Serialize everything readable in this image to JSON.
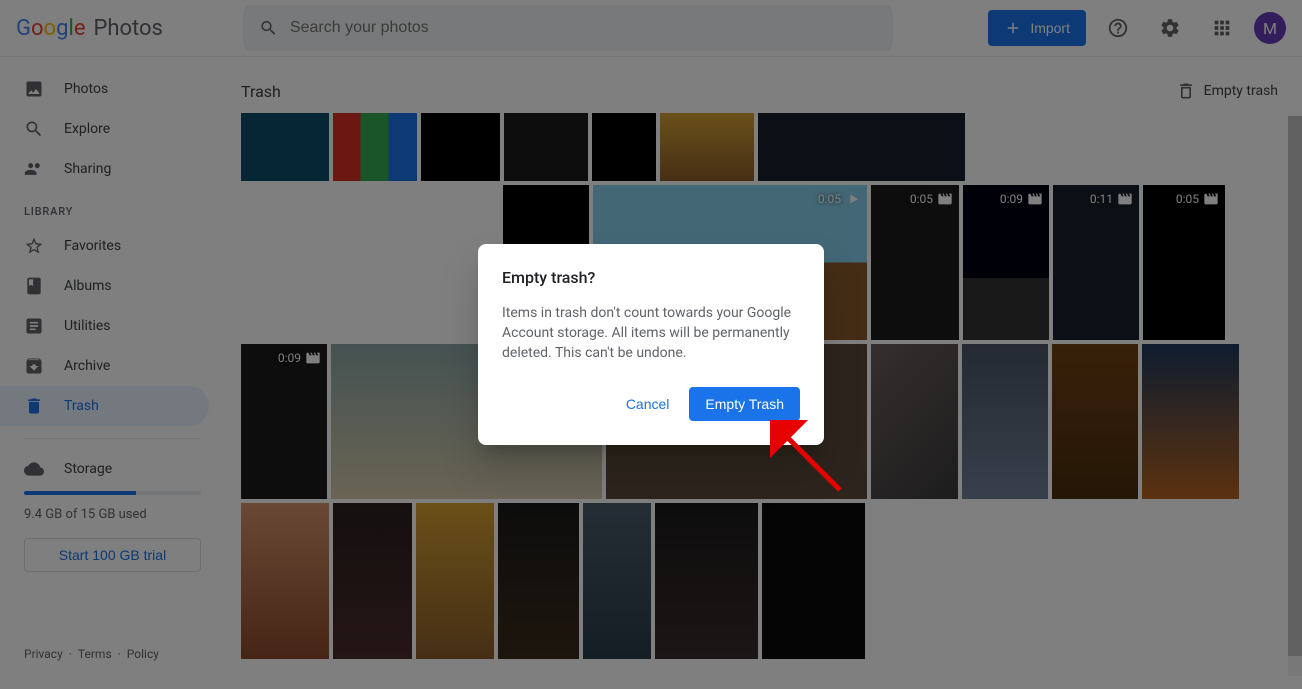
{
  "header": {
    "logo_suffix": "Photos",
    "search_placeholder": "Search your photos",
    "import_label": "Import",
    "avatar_letter": "M"
  },
  "sidebar": {
    "nav": [
      {
        "label": "Photos",
        "icon": "photo-icon"
      },
      {
        "label": "Explore",
        "icon": "search-icon"
      },
      {
        "label": "Sharing",
        "icon": "people-icon"
      }
    ],
    "library_label": "LIBRARY",
    "library": [
      {
        "label": "Favorites",
        "icon": "star-icon"
      },
      {
        "label": "Albums",
        "icon": "album-icon"
      },
      {
        "label": "Utilities",
        "icon": "utilities-icon"
      },
      {
        "label": "Archive",
        "icon": "archive-icon"
      },
      {
        "label": "Trash",
        "icon": "trash-icon",
        "active": true
      }
    ],
    "storage": {
      "label": "Storage",
      "usage_text": "9.4 GB of 15 GB used",
      "trial_label": "Start 100 GB trial",
      "percent": 63
    },
    "footer": {
      "privacy": "Privacy",
      "terms": "Terms",
      "policy": "Policy"
    }
  },
  "main": {
    "title": "Trash",
    "empty_trash_label": "Empty trash",
    "video_durations": [
      "0:05",
      "0:05",
      "0:09",
      "0:11",
      "0:05",
      "0:09"
    ]
  },
  "dialog": {
    "title": "Empty trash?",
    "body": "Items in trash don't count towards your Google Account storage. All items will be permanently deleted. This can't be undone.",
    "cancel": "Cancel",
    "confirm": "Empty Trash"
  }
}
